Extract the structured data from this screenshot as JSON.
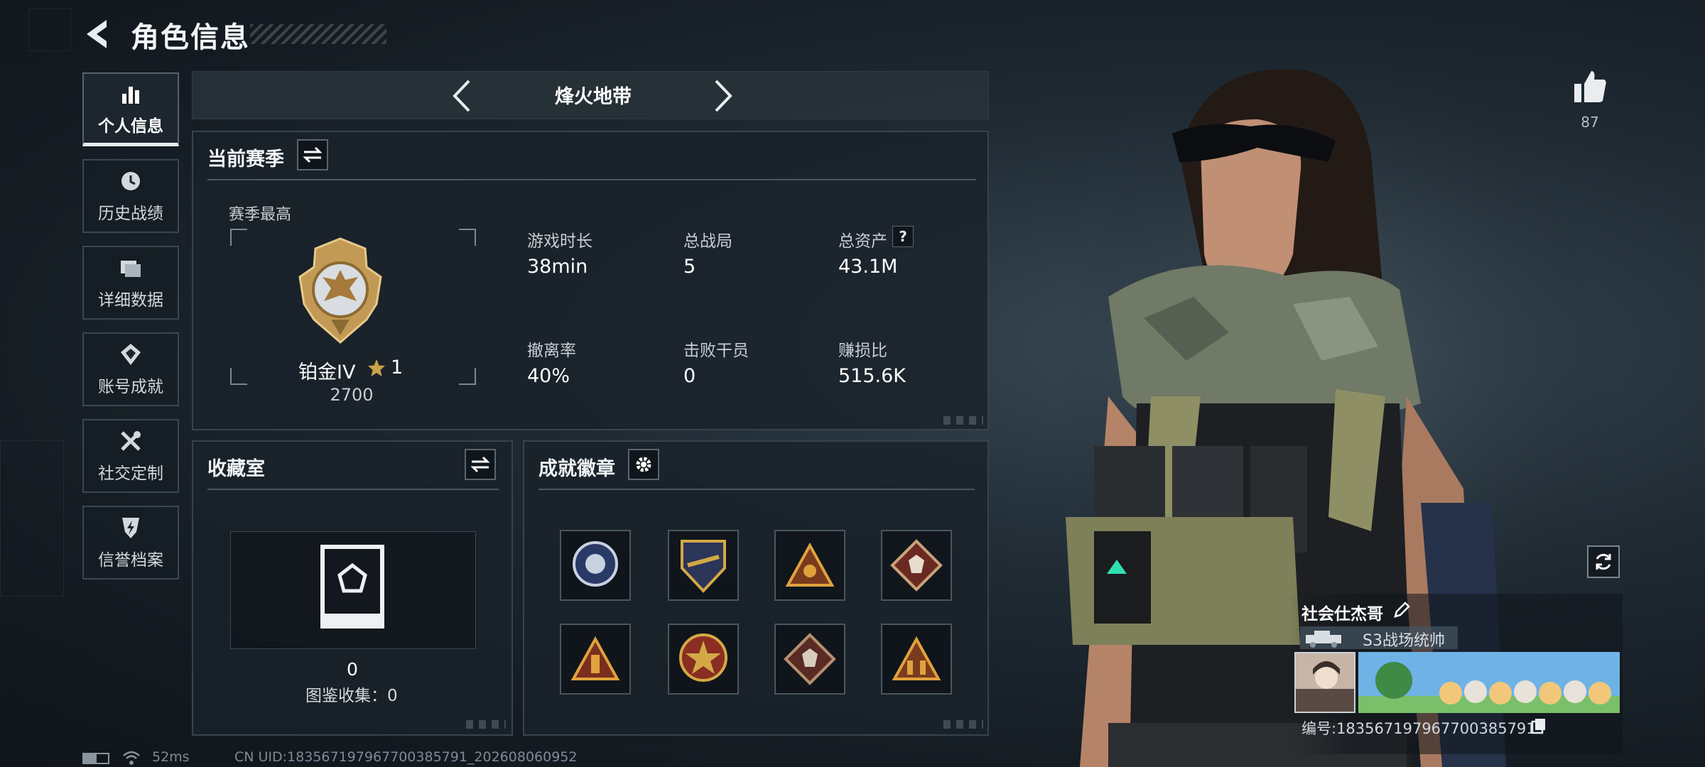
{
  "header": {
    "title": "角色信息"
  },
  "sidebar": {
    "items": [
      {
        "label": "个人信息",
        "active": true,
        "icon": "bar-chart-icon"
      },
      {
        "label": "历史战绩",
        "active": false,
        "icon": "clock-icon"
      },
      {
        "label": "详细数据",
        "active": false,
        "icon": "folder-icon"
      },
      {
        "label": "账号成就",
        "active": false,
        "icon": "achievement-icon"
      },
      {
        "label": "社交定制",
        "active": false,
        "icon": "tools-icon"
      },
      {
        "label": "信誉档案",
        "active": false,
        "icon": "shield-lightning-icon"
      }
    ]
  },
  "mode": {
    "title": "烽火地带"
  },
  "season": {
    "title": "当前赛季",
    "best_label": "赛季最高",
    "rank_name": "铂金IV",
    "rank_stars": "1",
    "rank_points": "2700",
    "stats": [
      {
        "label": "游戏时长",
        "value": "38min"
      },
      {
        "label": "总战局",
        "value": "5"
      },
      {
        "label": "总资产",
        "value": "43.1M"
      },
      {
        "label": "撤离率",
        "value": "40%"
      },
      {
        "label": "击败干员",
        "value": "0"
      },
      {
        "label": "赚损比",
        "value": "515.6K"
      }
    ]
  },
  "collection": {
    "title": "收藏室",
    "count": "0",
    "codex_label": "图鉴收集：0"
  },
  "badges": {
    "title": "成就徽章",
    "items": [
      "circle-emblem",
      "shield-eagle-emblem",
      "triangle-hand-emblem",
      "diamond-wolf-emblem",
      "triangle-tower-emblem",
      "circle-star-emblem",
      "diamond-wolf-emblem-2",
      "triangle-soldiers-emblem"
    ]
  },
  "social": {
    "likes": "87"
  },
  "player": {
    "name": "社会仕杰哥",
    "rank_title": "S3战场统帅",
    "id_text": "编号:183567197967700385791"
  },
  "status": {
    "ping": "52ms",
    "uid": "CN UID:183567197967700385791_202608060952"
  },
  "colors": {
    "accent": "#ffffff",
    "panel_border": "#38434c",
    "gold": "#c9a24a"
  }
}
